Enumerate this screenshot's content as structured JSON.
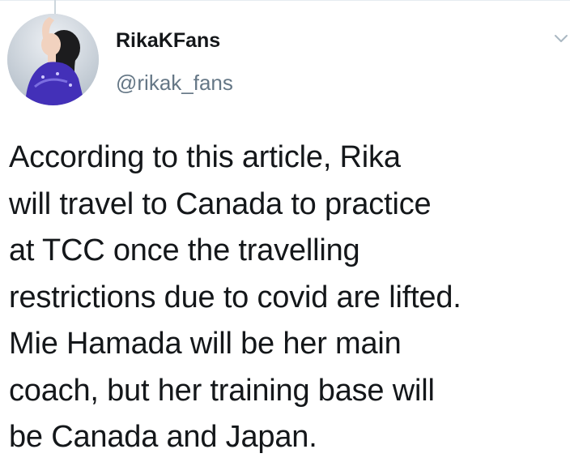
{
  "tweet": {
    "author": {
      "name": "RikaKFans",
      "handle": "@rikak_fans",
      "avatar_icon": "figure-skater-avatar"
    },
    "menu_icon": "chevron-down-icon",
    "text_lines": [
      "According to this article, Rika",
      "will travel to Canada to practice",
      "at TCC once the travelling",
      "restrictions due to covid are lifted.",
      "Mie Hamada will be her main",
      "coach, but her training base will",
      "be Canada and Japan."
    ]
  },
  "colors": {
    "text_primary": "#14171a",
    "text_secondary": "#657786",
    "thread_line": "#ccd6dd"
  }
}
